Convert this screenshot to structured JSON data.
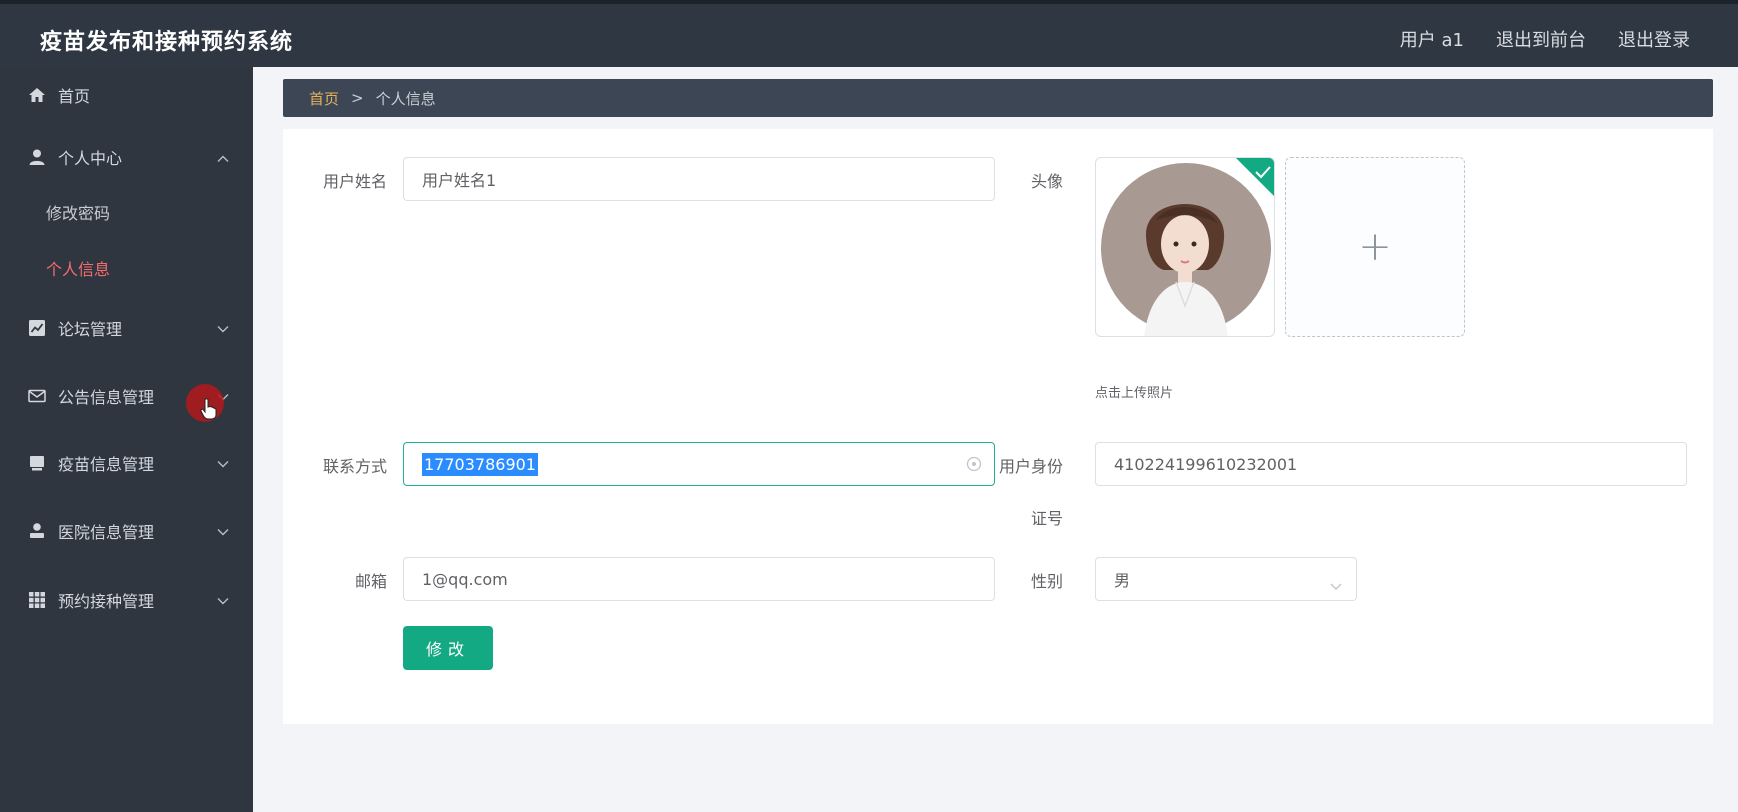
{
  "app": {
    "title": "疫苗发布和接种预约系统"
  },
  "topbar": {
    "user": "用户 a1",
    "back_front": "退出到前台",
    "logout": "退出登录"
  },
  "sidebar": {
    "items": [
      {
        "label": "首页",
        "icon": "home-icon"
      },
      {
        "label": "个人中心",
        "icon": "user-icon",
        "expanded": true
      },
      {
        "label": "论坛管理",
        "icon": "chart-icon"
      },
      {
        "label": "公告信息管理",
        "icon": "mail-icon"
      },
      {
        "label": "疫苗信息管理",
        "icon": "folder-icon"
      },
      {
        "label": "医院信息管理",
        "icon": "person-icon"
      },
      {
        "label": "预约接种管理",
        "icon": "grid-icon"
      }
    ],
    "subitems": [
      {
        "label": "修改密码",
        "active": false
      },
      {
        "label": "个人信息",
        "active": true
      }
    ]
  },
  "breadcrumb": {
    "home": "首页",
    "separator": ">",
    "current": "个人信息"
  },
  "form": {
    "username_label": "用户姓名",
    "username_value": "用户姓名1",
    "avatar_label": "头像",
    "upload_hint": "点击上传照片",
    "phone_label": "联系方式",
    "phone_value": "17703786901",
    "id_label_line1": "用户身份",
    "id_label_line2": "证号",
    "id_value": "410224199610232001",
    "email_label": "邮箱",
    "email_value": "1@qq.com",
    "gender_label": "性别",
    "gender_value": "男",
    "submit_label": "修改"
  },
  "colors": {
    "accent": "#13a983",
    "active_menu": "#f56c6c",
    "breadcrumb_home": "#e6b25c",
    "selection": "#2b8cff"
  }
}
